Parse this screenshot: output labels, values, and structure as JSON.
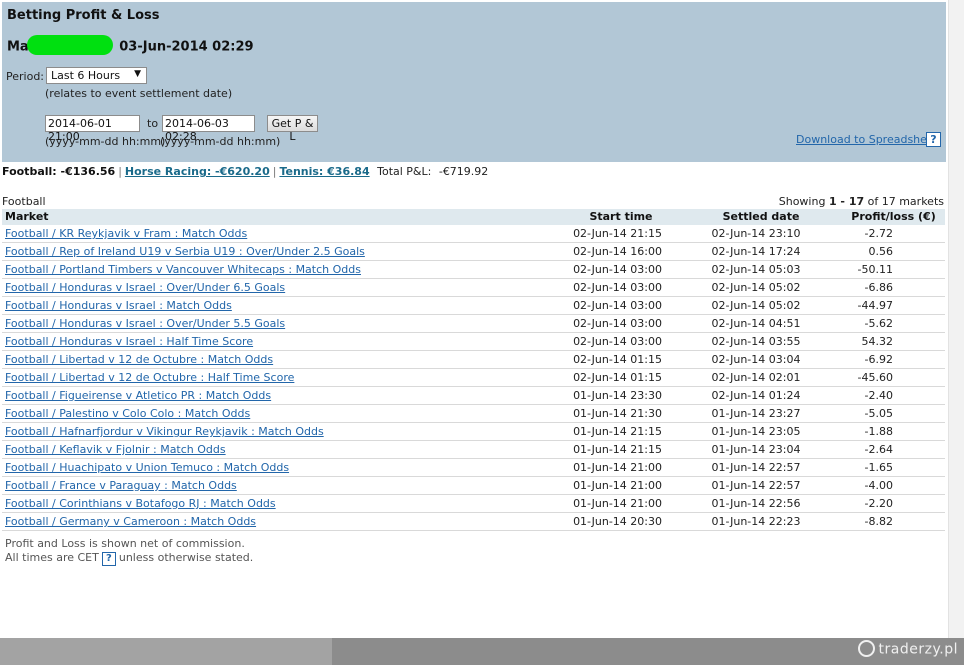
{
  "header": {
    "title": "Betting Profit & Loss",
    "account_prefix": "Ma",
    "account_date": "03-Jun-2014 02:29",
    "period_label": "Period:",
    "period_value": "Last 6 Hours",
    "period_note": "(relates to event settlement date)",
    "date_from": "2014-06-01 21:00",
    "to_label": "to",
    "date_to": "2014-06-03 02:28",
    "get_pl_label": "Get P & L",
    "format_hint": "(yyyy-mm-dd hh:mm)",
    "download_label": "Download to Spreadsheet",
    "help_glyph": "?"
  },
  "summary": {
    "football": "Football: -€136.56",
    "horse_racing": "Horse Racing: -€620.20",
    "tennis": "Tennis: €36.84",
    "total_label": "Total P&L:",
    "total_value": "-€719.92",
    "separator": "|"
  },
  "section": {
    "label": "Football",
    "showing_prefix": "Showing",
    "showing_range": "1 - 17",
    "showing_suffix": "of 17 markets"
  },
  "table": {
    "headers": {
      "market": "Market",
      "start": "Start time",
      "settled": "Settled date",
      "pl": "Profit/loss (€)"
    },
    "rows": [
      {
        "market": "Football / KR Reykjavik v Fram : Match Odds",
        "start": "02-Jun-14 21:15",
        "settled": "02-Jun-14 23:10",
        "pl": "-2.72"
      },
      {
        "market": "Football / Rep of Ireland U19 v Serbia U19 : Over/Under 2.5 Goals",
        "start": "02-Jun-14 16:00",
        "settled": "02-Jun-14 17:24",
        "pl": "0.56"
      },
      {
        "market": "Football / Portland Timbers v Vancouver Whitecaps : Match Odds",
        "start": "02-Jun-14 03:00",
        "settled": "02-Jun-14 05:03",
        "pl": "-50.11"
      },
      {
        "market": "Football / Honduras v Israel : Over/Under 6.5 Goals",
        "start": "02-Jun-14 03:00",
        "settled": "02-Jun-14 05:02",
        "pl": "-6.86"
      },
      {
        "market": "Football / Honduras v Israel : Match Odds",
        "start": "02-Jun-14 03:00",
        "settled": "02-Jun-14 05:02",
        "pl": "-44.97"
      },
      {
        "market": "Football / Honduras v Israel : Over/Under 5.5 Goals",
        "start": "02-Jun-14 03:00",
        "settled": "02-Jun-14 04:51",
        "pl": "-5.62"
      },
      {
        "market": "Football / Honduras v Israel : Half Time Score",
        "start": "02-Jun-14 03:00",
        "settled": "02-Jun-14 03:55",
        "pl": "54.32"
      },
      {
        "market": "Football / Libertad v 12 de Octubre : Match Odds",
        "start": "02-Jun-14 01:15",
        "settled": "02-Jun-14 03:04",
        "pl": "-6.92"
      },
      {
        "market": "Football / Libertad v 12 de Octubre : Half Time Score",
        "start": "02-Jun-14 01:15",
        "settled": "02-Jun-14 02:01",
        "pl": "-45.60"
      },
      {
        "market": "Football / Figueirense v Atletico PR : Match Odds",
        "start": "01-Jun-14 23:30",
        "settled": "02-Jun-14 01:24",
        "pl": "-2.40"
      },
      {
        "market": "Football / Palestino v Colo Colo : Match Odds",
        "start": "01-Jun-14 21:30",
        "settled": "01-Jun-14 23:27",
        "pl": "-5.05"
      },
      {
        "market": "Football / Hafnarfjordur v Vikingur Reykjavik : Match Odds",
        "start": "01-Jun-14 21:15",
        "settled": "01-Jun-14 23:05",
        "pl": "-1.88"
      },
      {
        "market": "Football / Keflavik v Fjolnir : Match Odds",
        "start": "01-Jun-14 21:15",
        "settled": "01-Jun-14 23:04",
        "pl": "-2.64"
      },
      {
        "market": "Football / Huachipato v Union Temuco : Match Odds",
        "start": "01-Jun-14 21:00",
        "settled": "01-Jun-14 22:57",
        "pl": "-1.65"
      },
      {
        "market": "Football / France v Paraguay : Match Odds",
        "start": "01-Jun-14 21:00",
        "settled": "01-Jun-14 22:57",
        "pl": "-4.00"
      },
      {
        "market": "Football / Corinthians v Botafogo RJ : Match Odds",
        "start": "01-Jun-14 21:00",
        "settled": "01-Jun-14 22:56",
        "pl": "-2.20"
      },
      {
        "market": "Football / Germany v Cameroon : Match Odds",
        "start": "01-Jun-14 20:30",
        "settled": "01-Jun-14 22:23",
        "pl": "-8.82"
      }
    ]
  },
  "footer": {
    "commission_note": "Profit and Loss is shown net of commission.",
    "times_prefix": "All times are CET",
    "times_suffix": "unless otherwise stated."
  },
  "watermark": {
    "text": "traderzy.pl",
    "icon": "traderzy-logo-icon"
  },
  "colors": {
    "header_panel": "#b2c7d6",
    "link": "#2266aa",
    "table_header": "#dfe9ee",
    "censor_blob": "#00e010"
  }
}
